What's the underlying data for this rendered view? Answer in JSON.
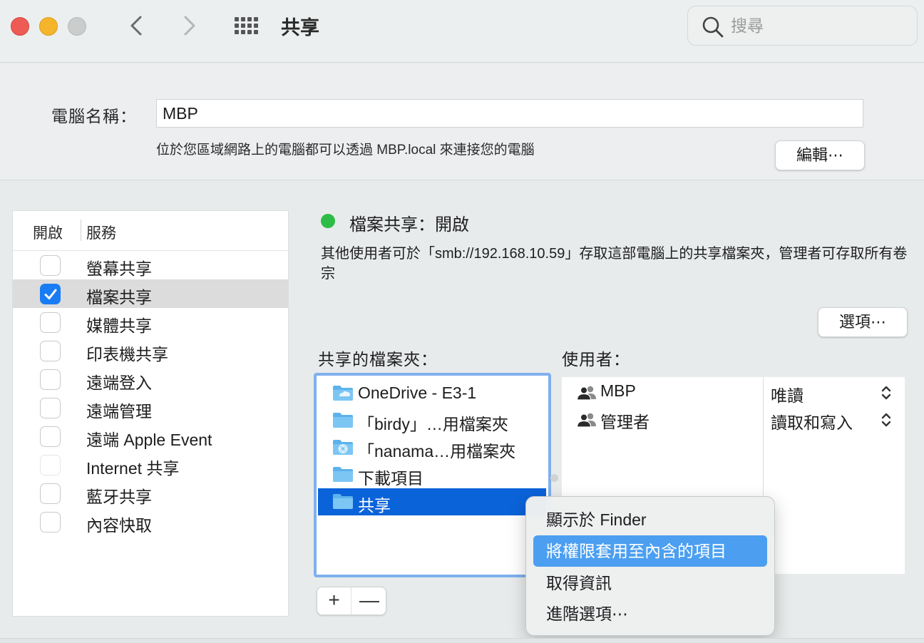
{
  "window": {
    "title": "共享",
    "search_placeholder": "搜尋"
  },
  "computer": {
    "label": "電腦名稱：",
    "name": "MBP",
    "description": "位於您區域網路上的電腦都可以透過 MBP.local 來連接您的電腦",
    "edit_label": "編輯⋯"
  },
  "services": {
    "header_on": "開啟",
    "header_service": "服務",
    "items": [
      {
        "name": "螢幕共享",
        "checked": false
      },
      {
        "name": "檔案共享",
        "checked": true,
        "selected": true
      },
      {
        "name": "媒體共享",
        "checked": false
      },
      {
        "name": "印表機共享",
        "checked": false
      },
      {
        "name": "遠端登入",
        "checked": false
      },
      {
        "name": "遠端管理",
        "checked": false
      },
      {
        "name": "遠端 Apple Event",
        "checked": false
      },
      {
        "name": "Internet 共享",
        "checked": false,
        "disabled": true
      },
      {
        "name": "藍牙共享",
        "checked": false
      },
      {
        "name": "內容快取",
        "checked": false
      }
    ]
  },
  "detail": {
    "status": "檔案共享：開啟",
    "status_color": "#2dbd46",
    "description": "其他使用者可於「smb://192.168.10.59」存取這部電腦上的共享檔案夾，管理者可存取所有卷宗",
    "options_label": "選項⋯",
    "folders_label": "共享的檔案夾：",
    "users_label": "使用者："
  },
  "folders": [
    {
      "name": "OneDrive - E3-1",
      "icon": "cloud-folder-icon"
    },
    {
      "name": "「birdy」…用檔案夾",
      "icon": "folder-icon"
    },
    {
      "name": "「nanama…用檔案夾",
      "icon": "public-folder-icon"
    },
    {
      "name": "下載項目",
      "icon": "folder-icon"
    },
    {
      "name": "共享",
      "icon": "folder-icon",
      "selected": true
    }
  ],
  "users": [
    {
      "name": "MBP",
      "permission": "唯讀"
    },
    {
      "name": "管理者",
      "permission": "讀取和寫入"
    }
  ],
  "buttons": {
    "plus": "+",
    "minus": "—"
  },
  "context_menu": [
    {
      "label": "顯示於 Finder"
    },
    {
      "label": "將權限套用至內含的項目",
      "highlighted": true
    },
    {
      "label": "取得資訊"
    },
    {
      "label": "進階選項⋯"
    }
  ]
}
